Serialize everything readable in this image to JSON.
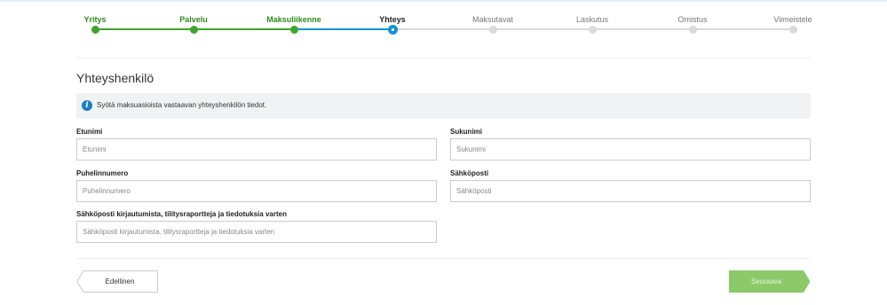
{
  "stepper": {
    "steps": [
      {
        "label": "Yritys",
        "state": "done"
      },
      {
        "label": "Palvelu",
        "state": "done"
      },
      {
        "label": "Maksuliikenne",
        "state": "done"
      },
      {
        "label": "Yhteys",
        "state": "current"
      },
      {
        "label": "Maksutavat",
        "state": "todo"
      },
      {
        "label": "Laskutus",
        "state": "todo"
      },
      {
        "label": "Omistus",
        "state": "todo"
      },
      {
        "label": "Viimeistele",
        "state": "todo"
      }
    ]
  },
  "section": {
    "title": "Yhteyshenkilö",
    "info": "Syötä maksuasioista vastaavan yhteyshenkilön tiedot."
  },
  "form": {
    "first_name": {
      "label": "Etunimi",
      "placeholder": "Etunimi",
      "value": ""
    },
    "last_name": {
      "label": "Sukunimi",
      "placeholder": "Sukunimi",
      "value": ""
    },
    "phone": {
      "label": "Puhelinnumero",
      "placeholder": "Puhelinnumero",
      "value": ""
    },
    "email": {
      "label": "Sähköposti",
      "placeholder": "Sähköposti",
      "value": ""
    },
    "login_email": {
      "label": "Sähköposti kirjautumista, tilitysraportteja ja tiedotuksia varten",
      "placeholder": "Sähköposti kirjautumista, tilitysraportteja ja tiedotuksia varten",
      "value": ""
    }
  },
  "nav": {
    "prev_label": "Edellinen",
    "next_label": "Seuraava"
  },
  "colors": {
    "done": "#3ea42b",
    "current": "#1493d5",
    "todo": "#d8dadc",
    "next_button": "#8cc968"
  }
}
